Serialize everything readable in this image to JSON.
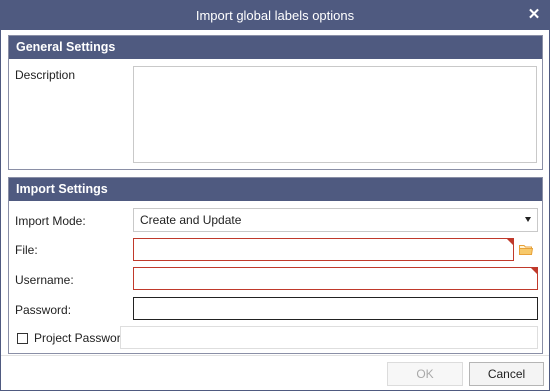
{
  "dialog": {
    "title": "Import global labels options"
  },
  "general": {
    "header": "General Settings",
    "description_label": "Description",
    "description_value": ""
  },
  "import": {
    "header": "Import Settings",
    "mode_label": "Import Mode:",
    "mode_value": "Create and Update",
    "file_label": "File:",
    "file_value": "",
    "username_label": "Username:",
    "username_value": "",
    "password_label": "Password:",
    "password_value": "",
    "project_password_label": "Project Password:",
    "project_password_value": "",
    "project_password_checked": false
  },
  "footer": {
    "ok_label": "OK",
    "cancel_label": "Cancel"
  },
  "icons": {
    "close": "close-icon",
    "folder": "folder-icon",
    "dropdown": "chevron-down-icon"
  },
  "colors": {
    "header_bg": "#4f5a80",
    "error_border": "#c0392b",
    "folder_icon": "#e8a23a"
  }
}
